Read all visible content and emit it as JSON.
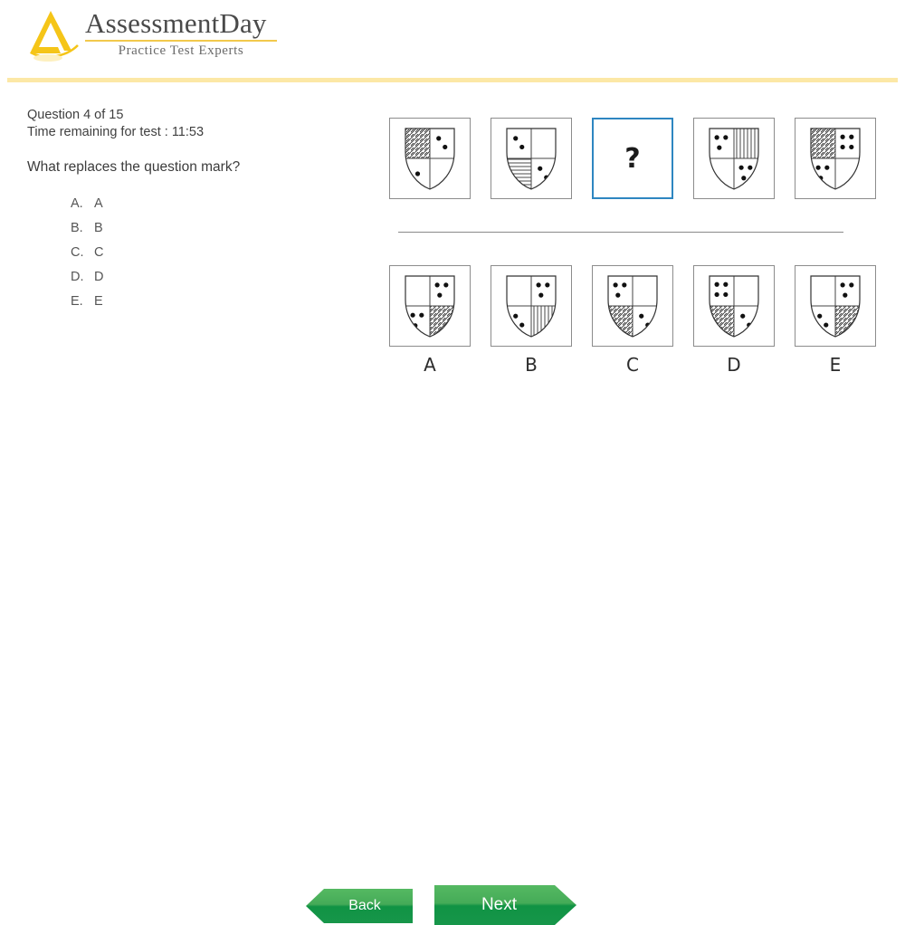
{
  "brand": {
    "name": "AssessmentDay",
    "tagline": "Practice Test Experts",
    "logo_icon": "assessmentday-triangle-logo",
    "accent_color": "#f2c94c"
  },
  "question": {
    "counter": "Question 4 of 15",
    "timer": "Time remaining for test : 11:53",
    "prompt": "What replaces the question mark?",
    "options": [
      {
        "key": "A.",
        "label": "A"
      },
      {
        "key": "B.",
        "label": "B"
      },
      {
        "key": "C.",
        "label": "C"
      },
      {
        "key": "D.",
        "label": "D"
      },
      {
        "key": "E.",
        "label": "E"
      }
    ]
  },
  "sequence": {
    "missing_marker": "?",
    "missing_index": 2,
    "missing_border_color": "#2e86c1",
    "shields": [
      {
        "name": "sequence-shield-1",
        "top_left": "hatch-diagonal",
        "top_right": "dots-2",
        "bottom_left": "dots-1",
        "bottom_right": "blank"
      },
      {
        "name": "sequence-shield-2",
        "top_left": "dots-2",
        "top_right": "blank",
        "bottom_left": "hatch-horizontal",
        "bottom_right": "dots-2"
      },
      {
        "name": "sequence-shield-missing",
        "top_left": "question",
        "top_right": "question",
        "bottom_left": "question",
        "bottom_right": "question"
      },
      {
        "name": "sequence-shield-4",
        "top_left": "dots-3",
        "top_right": "hatch-vertical",
        "bottom_left": "blank",
        "bottom_right": "dots-3"
      },
      {
        "name": "sequence-shield-5",
        "top_left": "hatch-diagonal",
        "top_right": "dots-4",
        "bottom_left": "dots-3",
        "bottom_right": "blank"
      }
    ]
  },
  "answers": {
    "shields": [
      {
        "label": "A",
        "top_left": "blank",
        "top_right": "dots-3",
        "bottom_left": "dots-3",
        "bottom_right": "hatch-diagonal"
      },
      {
        "label": "B",
        "top_left": "blank",
        "top_right": "dots-3",
        "bottom_left": "dots-2",
        "bottom_right": "hatch-vertical"
      },
      {
        "label": "C",
        "top_left": "dots-3",
        "top_right": "blank",
        "bottom_left": "hatch-diagonal",
        "bottom_right": "dots-2"
      },
      {
        "label": "D",
        "top_left": "dots-4",
        "top_right": "blank",
        "bottom_left": "hatch-diagonal",
        "bottom_right": "dots-2"
      },
      {
        "label": "E",
        "top_left": "blank",
        "top_right": "dots-3",
        "bottom_left": "dots-2",
        "bottom_right": "hatch-diagonal"
      }
    ]
  },
  "navigation": {
    "back_label": "Back",
    "next_label": "Next",
    "button_color": "#17964a"
  }
}
